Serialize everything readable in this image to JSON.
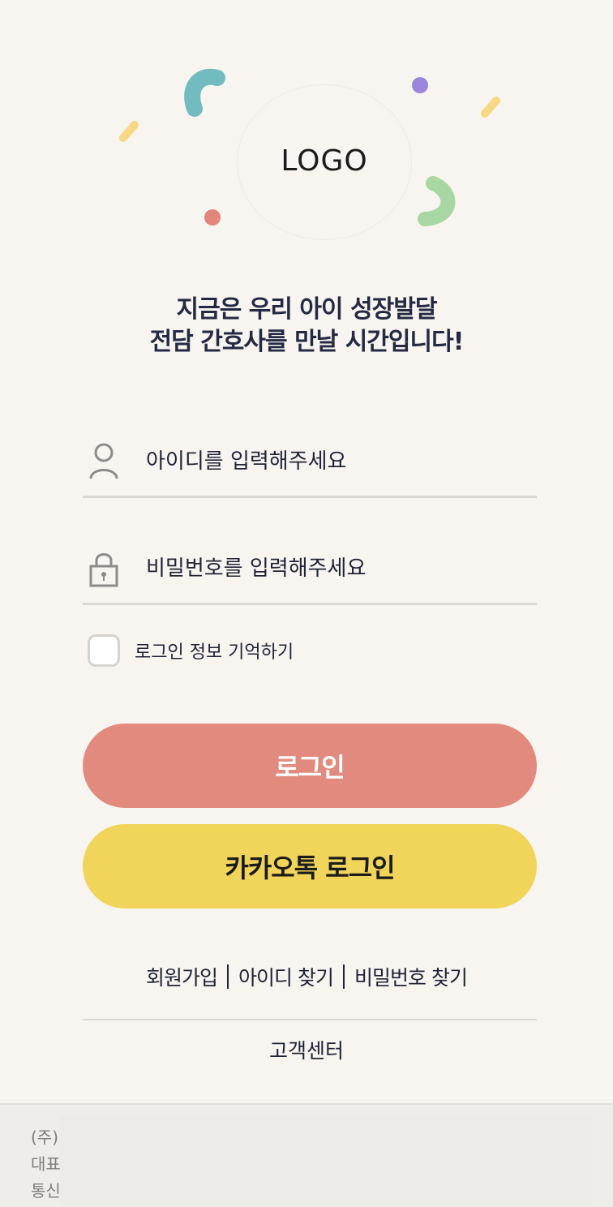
{
  "logo": {
    "text": "LOGO"
  },
  "headline": {
    "line1": "지금은 우리 아이 성장발달",
    "line2": "전담 간호사를 만날 시간입니다!"
  },
  "login_form": {
    "id_placeholder": "아이디를 입력해주세요",
    "id_value": "",
    "password_placeholder": "비밀번호를 입력해주세요",
    "password_value": "",
    "remember_label": "로그인 정보 기억하기",
    "remember_checked": false
  },
  "buttons": {
    "login": "로그인",
    "kakao_login": "카카오톡 로그인"
  },
  "links": {
    "signup": "회원가입",
    "find_id": "아이디 찾기",
    "find_password": "비밀번호 찾기",
    "customer_center": "고객센터"
  },
  "footer": {
    "line1": "(주)",
    "line2": "대표",
    "line3": "통신"
  },
  "colors": {
    "background": "#f8f5f0",
    "login_button": "#e28a7e",
    "kakao_button": "#f1d45a",
    "text": "#1f2235",
    "footer_bg": "#efedea"
  },
  "icons": {
    "id_field": "user-icon",
    "password_field": "lock-icon"
  }
}
